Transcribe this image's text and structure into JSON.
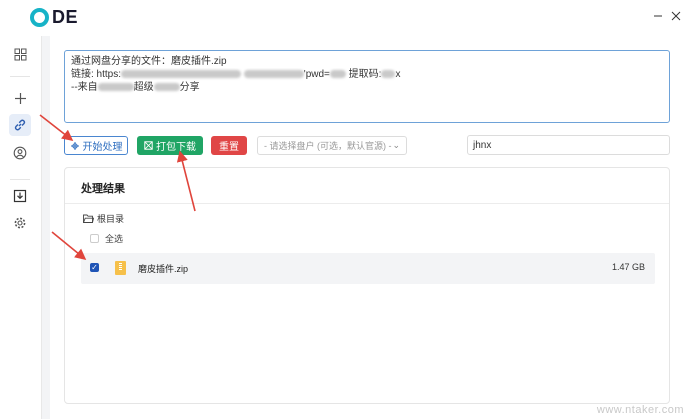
{
  "app": {
    "logo_text": "DE"
  },
  "window": {
    "minimize_icon": "minimize-icon",
    "close_icon": "close-icon"
  },
  "sidebar": {
    "items": [
      {
        "icon": "grid-icon"
      },
      {
        "icon": "plus-icon"
      },
      {
        "icon": "link-icon",
        "active": true
      },
      {
        "icon": "user-circle-icon"
      },
      {
        "icon": "download-box-icon"
      },
      {
        "icon": "gear-icon"
      }
    ]
  },
  "input": {
    "line1": "通过网盘分享的文件：磨皮插件.zip",
    "line2_prefix": "链接: https:",
    "line2_mid": "'pwd=",
    "line2_code_label": "提取码:",
    "line2_suffix": "x",
    "line3_prefix": "--来自",
    "line3_mid": "超级",
    "line3_suffix": "分享"
  },
  "toolbar": {
    "start_label": "开始处理",
    "download_label": "打包下载",
    "reset_label": "重置",
    "disk_select_placeholder": "请选择盘户 (可选，默认官源)",
    "code_value": "jhnx"
  },
  "result": {
    "title": "处理结果",
    "root_label": "根目录",
    "select_all_label": "全选",
    "files": [
      {
        "name": "磨皮插件.zip",
        "size": "1.47 GB",
        "checked": true
      }
    ]
  },
  "colors": {
    "accent": "#2f6fc0",
    "download": "#20a565",
    "reset": "#e04646",
    "logo": "#17b3c7",
    "arrow": "#e0453c"
  },
  "watermark": "www.ntaker.com"
}
